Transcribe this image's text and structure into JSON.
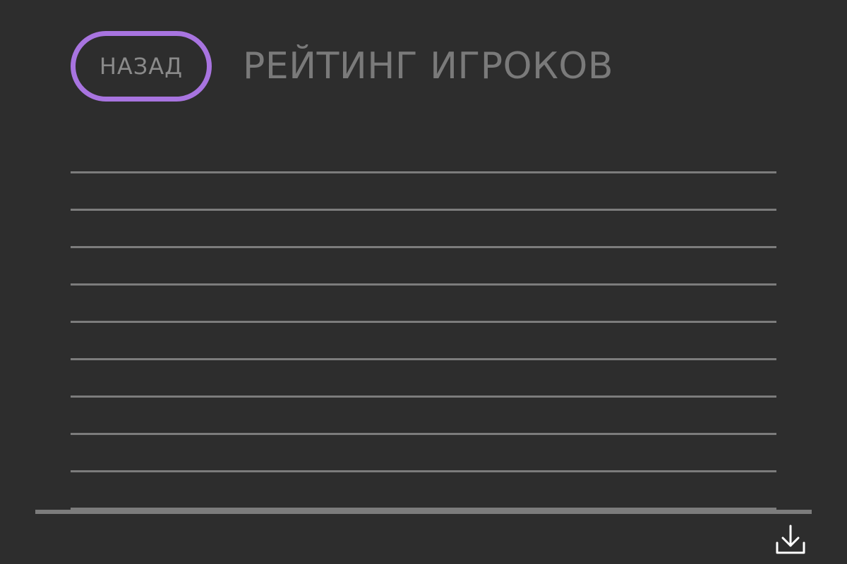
{
  "header": {
    "back_label": "НАЗАД",
    "title": "РЕЙТИНГ ИГРОКОВ"
  },
  "leaderboard": {
    "rows": [
      "",
      "",
      "",
      "",
      "",
      "",
      "",
      "",
      "",
      ""
    ]
  },
  "footer": {
    "download_icon": "download-icon"
  },
  "colors": {
    "background": "#2d2d2d",
    "accent": "#a874e0",
    "text": "#7a7a7a",
    "divider": "#7c7c7c",
    "icon": "#ffffff"
  }
}
